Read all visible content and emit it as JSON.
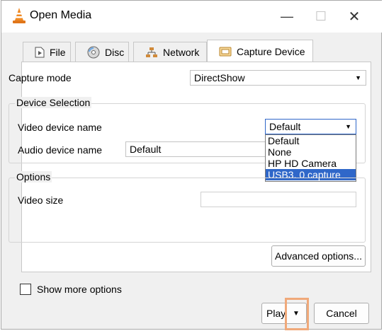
{
  "window": {
    "title": "Open Media",
    "min_glyph": "—",
    "max_glyph": "☐",
    "close_glyph": "✕"
  },
  "tabs": [
    {
      "label": "File",
      "icon": "file-icon"
    },
    {
      "label": "Disc",
      "icon": "disc-icon"
    },
    {
      "label": "Network",
      "icon": "network-icon"
    },
    {
      "label": "Capture Device",
      "icon": "capture-device-icon",
      "active": true
    }
  ],
  "capture": {
    "mode_label": "Capture mode",
    "mode_value": "DirectShow"
  },
  "device_selection": {
    "legend": "Device Selection",
    "video_label": "Video device name",
    "video_value": "Default",
    "audio_label": "Audio device name",
    "audio_value": "Default",
    "dropdown_options": [
      "Default",
      "None",
      "HP HD Camera",
      "USB3. 0 capture"
    ],
    "highlighted_option": "USB3. 0 capture"
  },
  "options": {
    "legend": "Options",
    "video_size_label": "Video size",
    "video_size_value": ""
  },
  "advanced_button": "Advanced options...",
  "show_more": {
    "label": "Show more options",
    "checked": false
  },
  "footer": {
    "play_label": "Play",
    "cancel_label": "Cancel"
  },
  "colors": {
    "selection": "#2f67c9",
    "annotation_box": "#f0a97a"
  }
}
